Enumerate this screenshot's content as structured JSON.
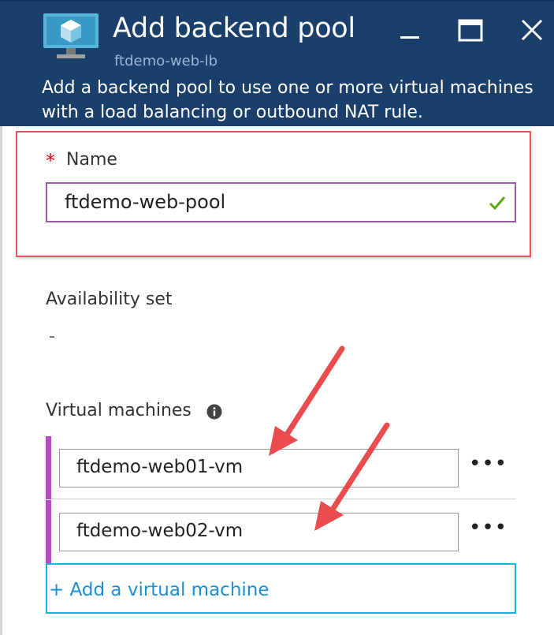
{
  "blade": {
    "title": "Add backend pool",
    "subtitle": "ftdemo-web-lb",
    "description": "Add a backend pool to use one or more virtual machines with a load balancing or outbound NAT rule.",
    "resource_icon": "virtual-machine-icon",
    "controls": [
      "minimize-icon",
      "maximize-icon",
      "close-icon"
    ]
  },
  "form": {
    "name": {
      "required_marker": "*",
      "label": "Name",
      "value": "ftdemo-web-pool",
      "valid_icon": "checkmark-icon"
    },
    "availability_set": {
      "label": "Availability set",
      "value": "-"
    },
    "virtual_machines": {
      "label": "Virtual machines",
      "info_icon": "info-icon",
      "items": [
        {
          "name": "ftdemo-web01-vm",
          "more": "•••"
        },
        {
          "name": "ftdemo-web02-vm",
          "more": "•••"
        }
      ],
      "add_label": "+ Add a virtual machine"
    }
  },
  "colors": {
    "header_bg": "#1b3f6b",
    "highlight_border": "#e8545a",
    "arrow": "#e94b4e",
    "row_accent": "#b84ac6",
    "link": "#1a8fd8",
    "valid": "#5ea614"
  }
}
